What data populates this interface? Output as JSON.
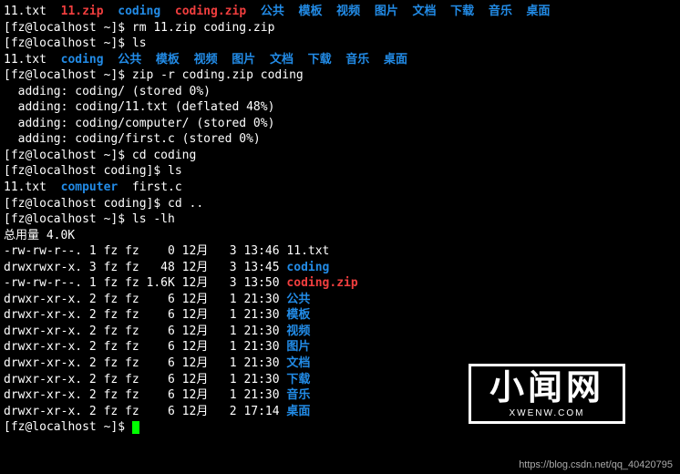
{
  "ls_top": [
    "11.txt",
    "11.zip",
    "coding",
    "coding.zip",
    "公共",
    "模板",
    "视频",
    "图片",
    "文档",
    "下载",
    "音乐",
    "桌面"
  ],
  "ls_top_classes": [
    "white",
    "red",
    "blue",
    "red",
    "blue",
    "blue",
    "blue",
    "blue",
    "blue",
    "blue",
    "blue",
    "blue"
  ],
  "cmd_rm": "[fz@localhost ~]$ rm 11.zip coding.zip",
  "cmd_ls1": "[fz@localhost ~]$ ls",
  "ls_after_rm": [
    "11.txt",
    "coding",
    "公共",
    "模板",
    "视频",
    "图片",
    "文档",
    "下载",
    "音乐",
    "桌面"
  ],
  "ls_after_rm_classes": [
    "white",
    "blue",
    "blue",
    "blue",
    "blue",
    "blue",
    "blue",
    "blue",
    "blue",
    "blue"
  ],
  "cmd_zip": "[fz@localhost ~]$ zip -r coding.zip coding",
  "zip_out": [
    "  adding: coding/ (stored 0%)",
    "  adding: coding/11.txt (deflated 48%)",
    "  adding: coding/computer/ (stored 0%)",
    "  adding: coding/first.c (stored 0%)"
  ],
  "cmd_cd_coding": "[fz@localhost ~]$ cd coding",
  "cmd_ls_coding": "[fz@localhost coding]$ ls",
  "ls_coding": [
    "11.txt",
    "computer",
    "first.c"
  ],
  "ls_coding_classes": [
    "white",
    "blue",
    "white"
  ],
  "cmd_cd_up": "[fz@localhost coding]$ cd ..",
  "cmd_lslh": "[fz@localhost ~]$ ls -lh",
  "total": "总用量 4.0K",
  "listing": [
    {
      "perm": "-rw-rw-r--.",
      "n": "1",
      "u": "fz",
      "g": "fz",
      "size": "   0",
      "mon": "12月",
      "day": " 3",
      "time": "13:46",
      "name": "11.txt",
      "cls": "white"
    },
    {
      "perm": "drwxrwxr-x.",
      "n": "3",
      "u": "fz",
      "g": "fz",
      "size": "  48",
      "mon": "12月",
      "day": " 3",
      "time": "13:45",
      "name": "coding",
      "cls": "blue"
    },
    {
      "perm": "-rw-rw-r--.",
      "n": "1",
      "u": "fz",
      "g": "fz",
      "size": "1.6K",
      "mon": "12月",
      "day": " 3",
      "time": "13:50",
      "name": "coding.zip",
      "cls": "red"
    },
    {
      "perm": "drwxr-xr-x.",
      "n": "2",
      "u": "fz",
      "g": "fz",
      "size": "   6",
      "mon": "12月",
      "day": " 1",
      "time": "21:30",
      "name": "公共",
      "cls": "blue"
    },
    {
      "perm": "drwxr-xr-x.",
      "n": "2",
      "u": "fz",
      "g": "fz",
      "size": "   6",
      "mon": "12月",
      "day": " 1",
      "time": "21:30",
      "name": "模板",
      "cls": "blue"
    },
    {
      "perm": "drwxr-xr-x.",
      "n": "2",
      "u": "fz",
      "g": "fz",
      "size": "   6",
      "mon": "12月",
      "day": " 1",
      "time": "21:30",
      "name": "视频",
      "cls": "blue"
    },
    {
      "perm": "drwxr-xr-x.",
      "n": "2",
      "u": "fz",
      "g": "fz",
      "size": "   6",
      "mon": "12月",
      "day": " 1",
      "time": "21:30",
      "name": "图片",
      "cls": "blue"
    },
    {
      "perm": "drwxr-xr-x.",
      "n": "2",
      "u": "fz",
      "g": "fz",
      "size": "   6",
      "mon": "12月",
      "day": " 1",
      "time": "21:30",
      "name": "文档",
      "cls": "blue"
    },
    {
      "perm": "drwxr-xr-x.",
      "n": "2",
      "u": "fz",
      "g": "fz",
      "size": "   6",
      "mon": "12月",
      "day": " 1",
      "time": "21:30",
      "name": "下载",
      "cls": "blue"
    },
    {
      "perm": "drwxr-xr-x.",
      "n": "2",
      "u": "fz",
      "g": "fz",
      "size": "   6",
      "mon": "12月",
      "day": " 1",
      "time": "21:30",
      "name": "音乐",
      "cls": "blue"
    },
    {
      "perm": "drwxr-xr-x.",
      "n": "2",
      "u": "fz",
      "g": "fz",
      "size": "   6",
      "mon": "12月",
      "day": " 2",
      "time": "17:14",
      "name": "桌面",
      "cls": "blue"
    }
  ],
  "prompt_final": "[fz@localhost ~]$ ",
  "watermark_cn": "小闻网",
  "watermark_en": "XWENW.COM",
  "footer_url": "https://blog.csdn.net/qq_40420795"
}
